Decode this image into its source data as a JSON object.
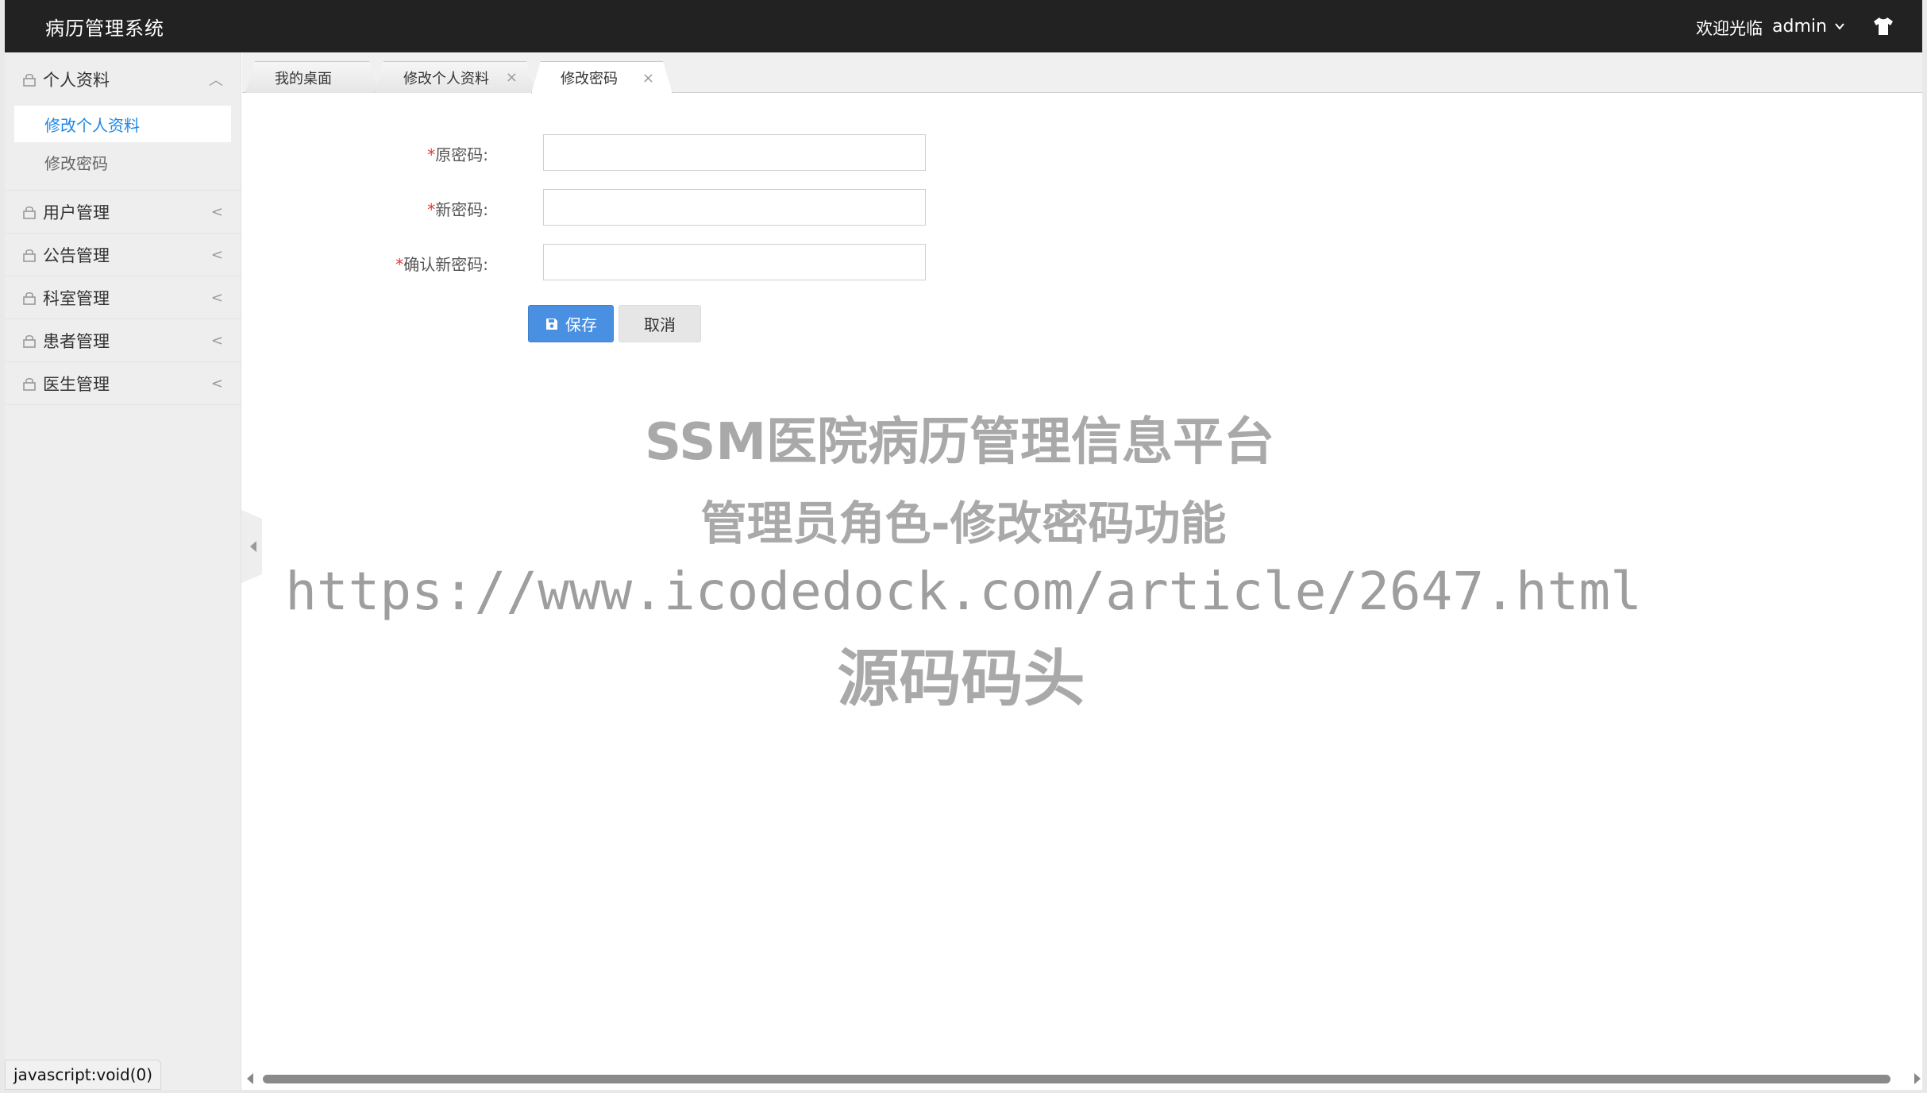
{
  "header": {
    "app_title": "病历管理系统",
    "welcome": "欢迎光临",
    "username": "admin"
  },
  "sidebar": {
    "groups": [
      {
        "label": "个人资料",
        "arrow": "︿",
        "items": [
          {
            "label": "修改个人资料",
            "active": true
          },
          {
            "label": "修改密码",
            "active": false
          }
        ]
      },
      {
        "label": "用户管理",
        "arrow": "<"
      },
      {
        "label": "公告管理",
        "arrow": "<"
      },
      {
        "label": "科室管理",
        "arrow": "<"
      },
      {
        "label": "患者管理",
        "arrow": "<"
      },
      {
        "label": "医生管理",
        "arrow": "<"
      }
    ]
  },
  "tabs": [
    {
      "label": "我的桌面"
    },
    {
      "label": "修改个人资料",
      "close": "×"
    },
    {
      "label": "修改密码",
      "close": "×",
      "active": true
    }
  ],
  "form": {
    "required_mark": "*",
    "old_password_label": "原密码:",
    "new_password_label": "新密码:",
    "confirm_password_label": "确认新密码:",
    "old_password_value": "",
    "new_password_value": "",
    "confirm_password_value": "",
    "save_label": "保存",
    "cancel_label": "取消"
  },
  "watermark": {
    "line1": "SSM医院病历管理信息平台",
    "line2": "管理员角色-修改密码功能",
    "line3": "https://www.icodedock.com/article/2647.html",
    "line4": "源码码头"
  },
  "statusbar": {
    "text": "javascript:void(0)"
  },
  "colors": {
    "header_bg": "#222222",
    "sidebar_bg": "#eeeeee",
    "active_link": "#1e88e5",
    "save_button": "#4a90e2",
    "required": "#e53935"
  }
}
